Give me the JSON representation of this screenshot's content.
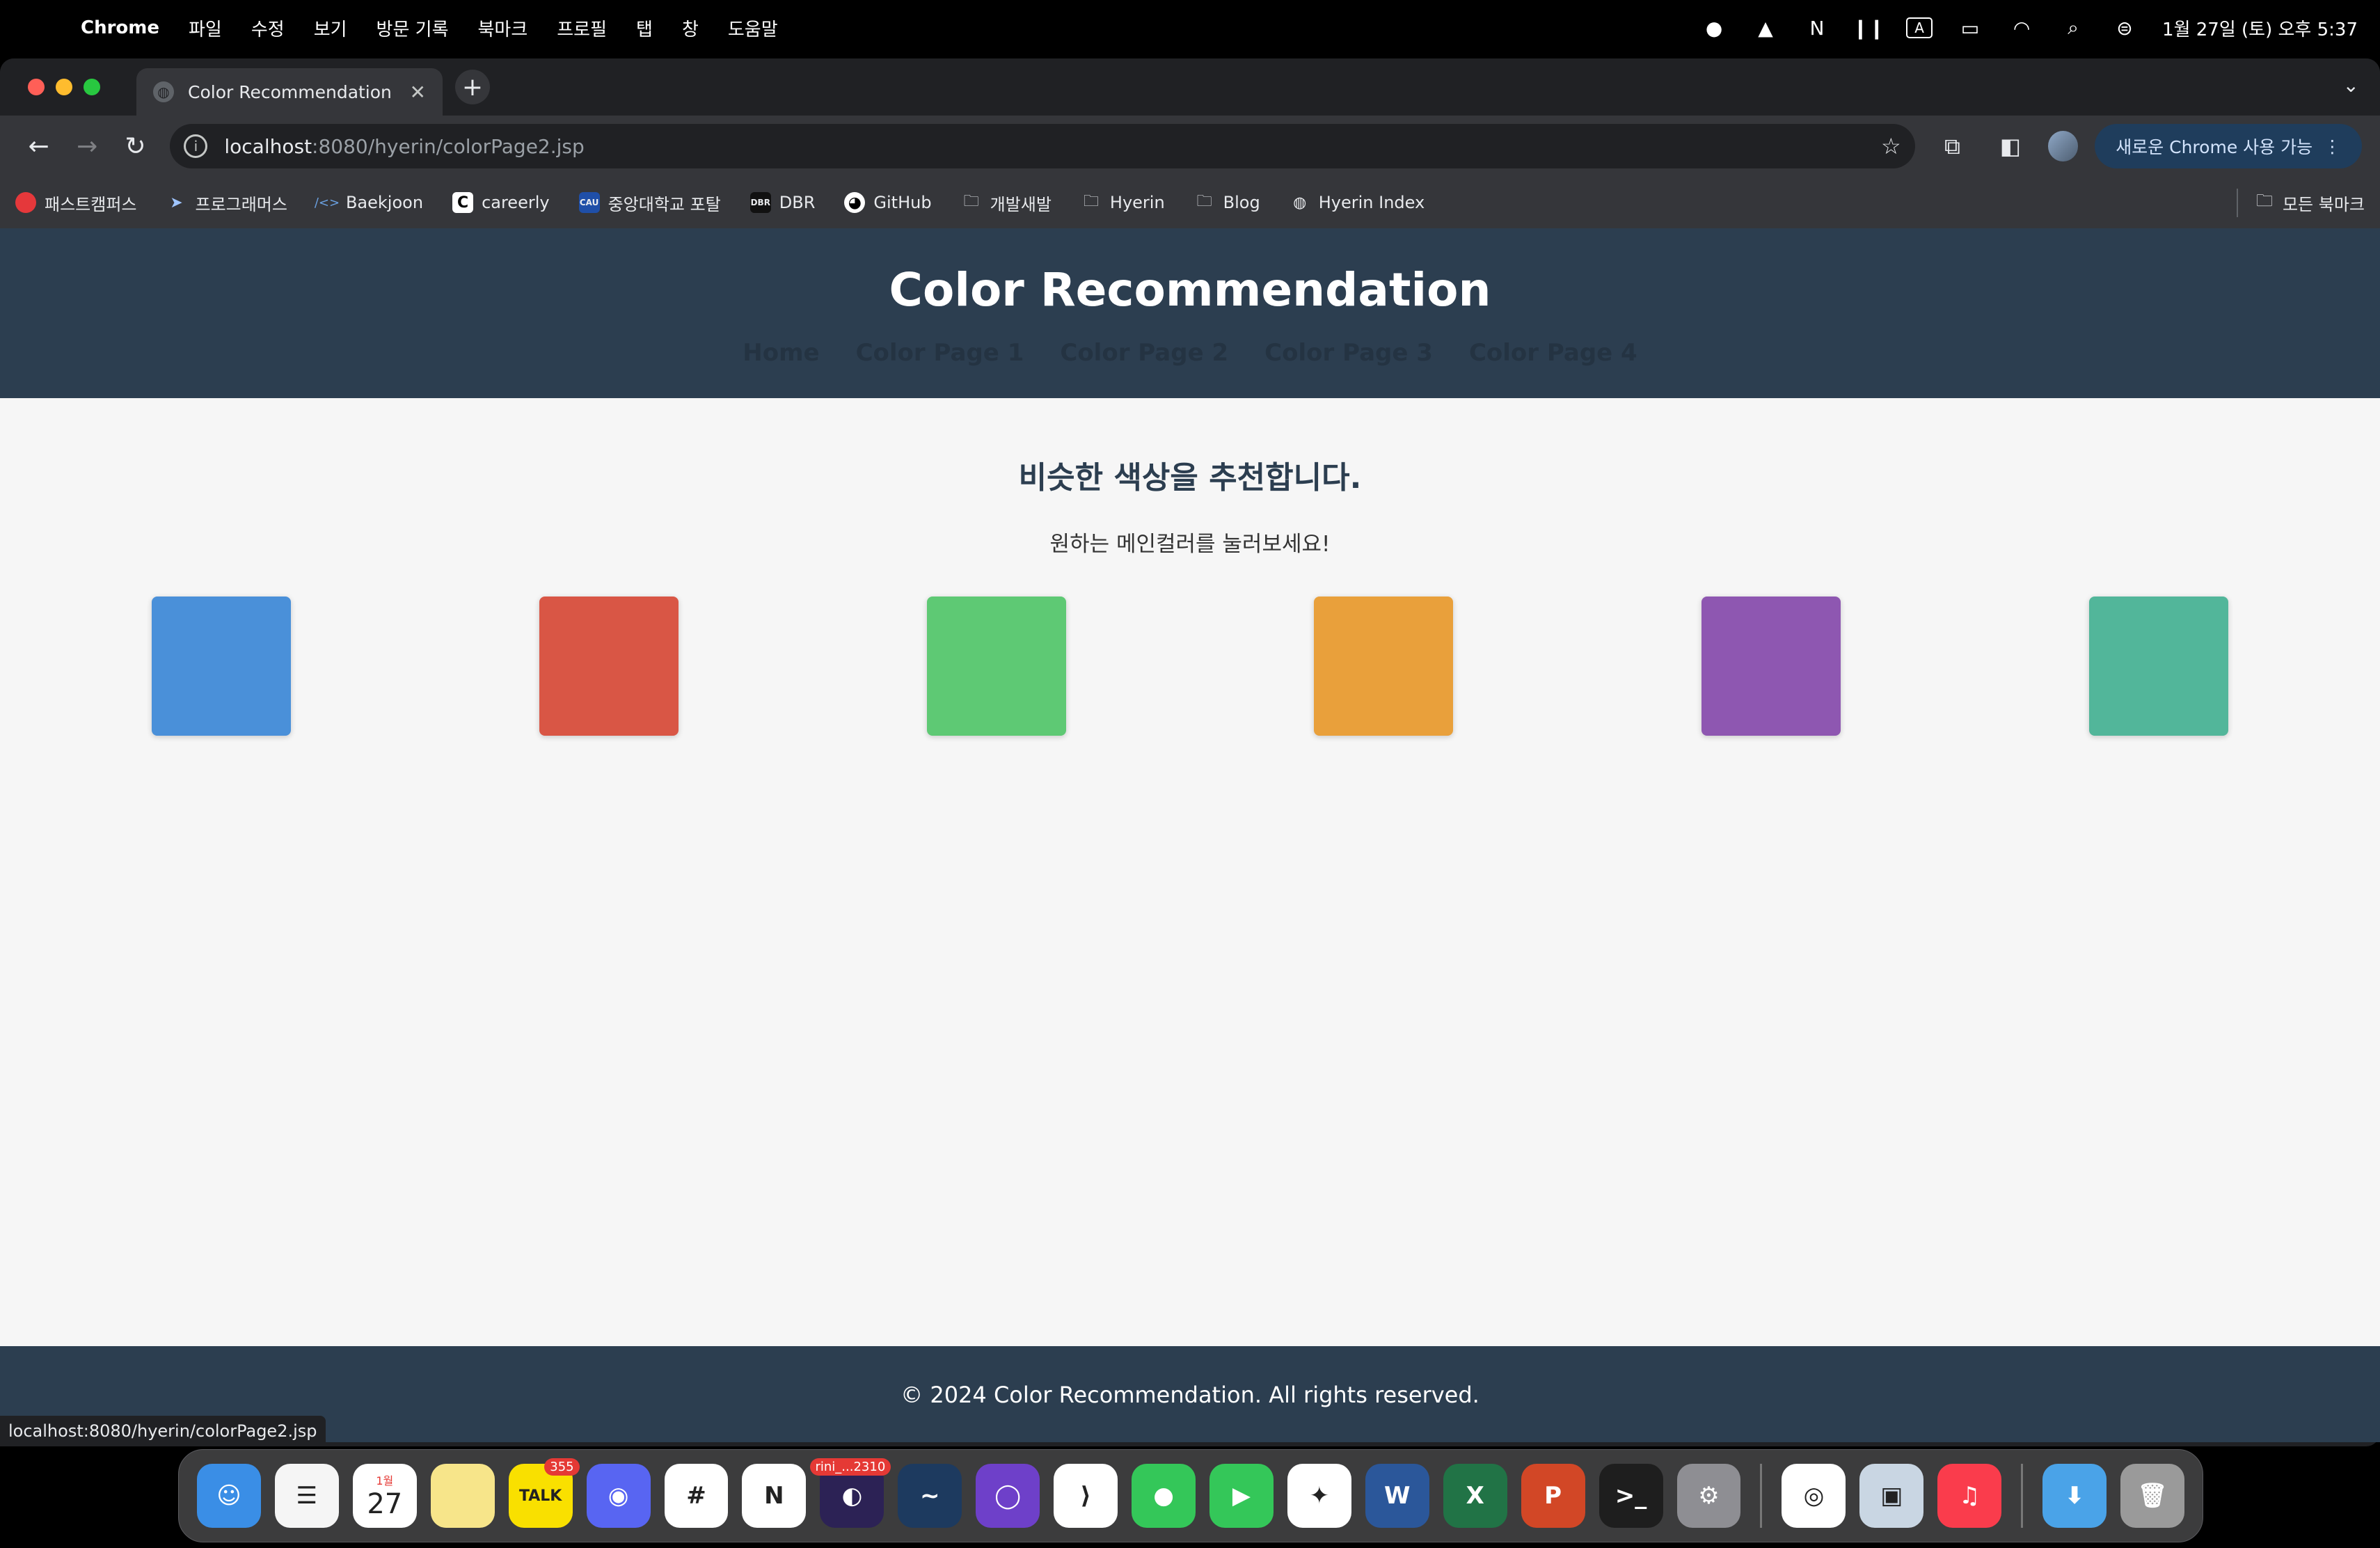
{
  "menubar": {
    "app": "Chrome",
    "items": [
      "파일",
      "수정",
      "보기",
      "방문 기록",
      "북마크",
      "프로필",
      "탭",
      "창",
      "도움말"
    ],
    "clock": "1월 27일 (토) 오후 5:37",
    "tray_icons": [
      "notification-icon",
      "drive-icon",
      "notion-icon",
      "airpods-icon",
      "input-source-icon",
      "battery-icon",
      "wifi-icon",
      "search-icon",
      "control-center-icon"
    ],
    "input_source_label": "A"
  },
  "browser": {
    "tab_title": "Color Recommendation",
    "url_host": "localhost",
    "url_path": ":8080/hyerin/colorPage2.jsp",
    "update_button": "새로운 Chrome 사용 가능",
    "bookmarks": [
      {
        "label": "패스트캠퍼스",
        "icon": "fastcampus-icon",
        "color": "#e5383b"
      },
      {
        "label": "프로그래머스",
        "icon": "programmers-icon",
        "color": "#1f2a44"
      },
      {
        "label": "Baekjoon",
        "icon": "baekjoon-icon",
        "color": "#3d6fa8"
      },
      {
        "label": "careerly",
        "icon": "careerly-icon",
        "color": "#ffffff"
      },
      {
        "label": "중앙대학교 포탈",
        "icon": "cau-icon",
        "color": "#1f4fa8"
      },
      {
        "label": "DBR",
        "icon": "dbr-icon",
        "color": "#222222"
      },
      {
        "label": "GitHub",
        "icon": "github-icon",
        "color": "#ffffff"
      },
      {
        "label": "개발새발",
        "icon": "folder-icon",
        "color": ""
      },
      {
        "label": "Hyerin",
        "icon": "folder-icon",
        "color": ""
      },
      {
        "label": "Blog",
        "icon": "folder-icon",
        "color": ""
      },
      {
        "label": "Hyerin Index",
        "icon": "globe-icon",
        "color": ""
      }
    ],
    "all_bookmarks": "모든 북마크",
    "status_url": "localhost:8080/hyerin/colorPage2.jsp"
  },
  "page": {
    "site_title": "Color Recommendation",
    "nav": [
      "Home",
      "Color Page 1",
      "Color Page 2",
      "Color Page 3",
      "Color Page 4"
    ],
    "heading": "비슷한 색상을 추천합니다.",
    "subheading": "원하는 메인컬러를 눌러보세요!",
    "swatches": [
      "#4a90d9",
      "#d95645",
      "#5ec974",
      "#e9a03b",
      "#8e57b1",
      "#52b69a"
    ],
    "footer": "© 2024 Color Recommendation. All rights reserved."
  },
  "dock": {
    "apps": [
      {
        "name": "finder",
        "bg": "#3a8ee6",
        "glyph": "☺",
        "badge": ""
      },
      {
        "name": "reminders",
        "bg": "#f5f5f5",
        "glyph": "☰",
        "badge": ""
      },
      {
        "name": "calendar",
        "bg": "#ffffff",
        "glyph": "27",
        "badge": "",
        "small_label": "1월"
      },
      {
        "name": "notes",
        "bg": "#f7e58a",
        "glyph": "",
        "badge": ""
      },
      {
        "name": "kakaotalk",
        "bg": "#f9e000",
        "glyph": "TALK",
        "badge": "355"
      },
      {
        "name": "discord",
        "bg": "#5865f2",
        "glyph": "◉",
        "badge": ""
      },
      {
        "name": "slack",
        "bg": "#ffffff",
        "glyph": "#",
        "badge": ""
      },
      {
        "name": "notion",
        "bg": "#ffffff",
        "glyph": "N",
        "badge": ""
      },
      {
        "name": "eclipse",
        "bg": "#2c2255",
        "glyph": "◐",
        "badge": "rini_...2310"
      },
      {
        "name": "mysql-workbench",
        "bg": "#1d3a5f",
        "glyph": "~",
        "badge": ""
      },
      {
        "name": "github-desktop",
        "bg": "#6e40c9",
        "glyph": "◯",
        "badge": ""
      },
      {
        "name": "vscode",
        "bg": "#ffffff",
        "glyph": "⟩",
        "badge": ""
      },
      {
        "name": "messages",
        "bg": "#34c759",
        "glyph": "●",
        "badge": ""
      },
      {
        "name": "facetime",
        "bg": "#34c759",
        "glyph": "▶",
        "badge": ""
      },
      {
        "name": "safari",
        "bg": "#ffffff",
        "glyph": "✦",
        "badge": ""
      },
      {
        "name": "word",
        "bg": "#2b579a",
        "glyph": "W",
        "badge": ""
      },
      {
        "name": "excel",
        "bg": "#217346",
        "glyph": "X",
        "badge": ""
      },
      {
        "name": "powerpoint",
        "bg": "#d24726",
        "glyph": "P",
        "badge": ""
      },
      {
        "name": "terminal",
        "bg": "#1e1e1e",
        "glyph": ">_",
        "badge": ""
      },
      {
        "name": "system-settings",
        "bg": "#8e8e93",
        "glyph": "⚙",
        "badge": ""
      },
      {
        "name": "chrome",
        "bg": "#ffffff",
        "glyph": "◎",
        "badge": ""
      },
      {
        "name": "preview",
        "bg": "#c9d6e3",
        "glyph": "▣",
        "badge": ""
      },
      {
        "name": "music",
        "bg": "#fa3c4c",
        "glyph": "♫",
        "badge": ""
      },
      {
        "name": "downloads",
        "bg": "#4aa3e8",
        "glyph": "⬇",
        "badge": ""
      },
      {
        "name": "trash",
        "bg": "#9a9a9a",
        "glyph": "🗑",
        "badge": ""
      }
    ]
  }
}
